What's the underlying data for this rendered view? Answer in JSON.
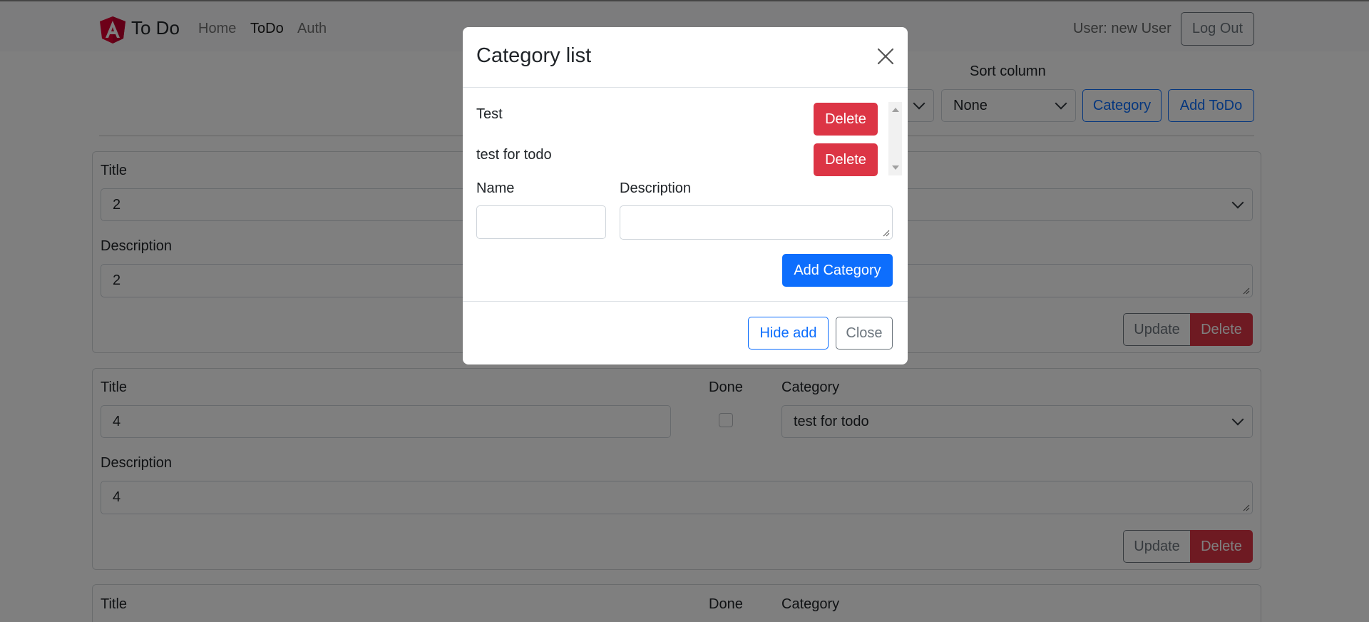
{
  "navbar": {
    "brand": "To Do",
    "links": [
      "Home",
      "ToDo",
      "Auth"
    ],
    "active_link": "ToDo",
    "user_text": "User: new User",
    "logout_label": "Log Out"
  },
  "toolbar": {
    "sort_column_label": "Sort column",
    "sort_column_value": "None",
    "category_button": "Category",
    "add_todo_button": "Add ToDo"
  },
  "todos": [
    {
      "title_label": "Title",
      "title_value": "2",
      "description_label": "Description",
      "description_value": "2",
      "update_label": "Update",
      "delete_label": "Delete"
    },
    {
      "title_label": "Title",
      "title_value": "4",
      "done_label": "Done",
      "done": false,
      "category_label": "Category",
      "category_value": "test for todo",
      "description_label": "Description",
      "description_value": "4",
      "update_label": "Update",
      "delete_label": "Delete"
    },
    {
      "title_label": "Title",
      "done_label": "Done",
      "category_label": "Category"
    }
  ],
  "modal": {
    "title": "Category list",
    "categories": [
      {
        "name": "Test",
        "delete_label": "Delete"
      },
      {
        "name": "test for todo",
        "delete_label": "Delete"
      }
    ],
    "name_label": "Name",
    "description_label": "Description",
    "name_value": "",
    "description_value": "",
    "add_category_label": "Add Category",
    "hide_add_label": "Hide add",
    "close_label": "Close"
  },
  "colors": {
    "primary": "#0d6efd",
    "danger": "#dc3545",
    "secondary": "#6c757d",
    "brand_logo": "#c3002f"
  }
}
